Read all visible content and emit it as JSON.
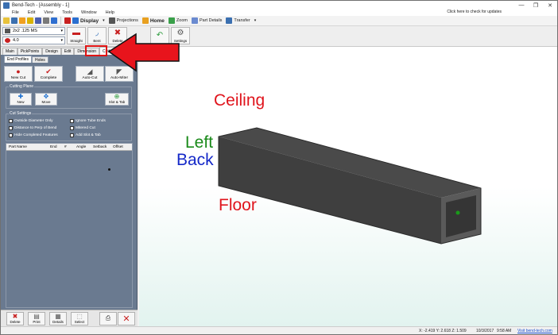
{
  "window": {
    "title": "Bend-Tech - [Assembly - 1]",
    "controls": [
      "—",
      "❐",
      "✕"
    ]
  },
  "menubar": {
    "items": [
      "File",
      "Edit",
      "View",
      "Tools",
      "Window",
      "Help"
    ],
    "update_notice": "Click here to check for updates"
  },
  "toolbar": {
    "display_label": "Display",
    "projections_label": "Projections",
    "home_label": "Home",
    "zoom_label": "Zoom",
    "part_details_label": "Part Details",
    "transfer_label": "Transfer"
  },
  "selectors": {
    "profile_value": "2x2 .125 MS",
    "radius_value": "4.0"
  },
  "bigbuttons": {
    "straight_label": "Straight",
    "bent_label": "Bent",
    "delete_label": "Delete",
    "settings_label": "Settings"
  },
  "tabs": [
    "Main",
    "PickPoints",
    "Design",
    "Edit",
    "Dimension",
    "Cutting"
  ],
  "active_tab": "Cutting",
  "subtabs": [
    "End Profiles",
    "Holes"
  ],
  "actions": {
    "new_cut": "New Cut",
    "complete": "Complete",
    "auto_cut": "Auto-Cut",
    "auto_miter": "Auto-Miter"
  },
  "cutting_plane": {
    "title": "Cutting Plane",
    "new_label": "New",
    "move_label": "Move",
    "slot_tab_label": "Slot & Tab"
  },
  "cut_settings": {
    "title": "Cut Settings",
    "options": [
      "Outside Diameter Only",
      "Ignore Tube Ends",
      "Distance to Perp of Bend",
      "Mitered Cut",
      "Hide Completed Features",
      "Add Slot & Tab"
    ]
  },
  "grid": {
    "columns": [
      "Part Name",
      "End",
      "#",
      "Angle",
      "Setback",
      "Offset"
    ]
  },
  "bottom_buttons": {
    "delete": "Delete",
    "print": "Print",
    "details": "Details",
    "select": "Select"
  },
  "viewport": {
    "labels": {
      "ceiling": "Ceiling",
      "left": "Left",
      "back": "Back",
      "floor": "Floor"
    },
    "colors": {
      "ceiling": "#e0141c",
      "left": "#1a8a1a",
      "back": "#1428c8",
      "floor": "#e0141c",
      "tube": "#444444",
      "callout_arrow": "#e8141c"
    }
  },
  "status": {
    "coords": "X: -2.419  Y: 2.618  Z: 1.509",
    "date": "10/3/2017",
    "time": "9:58 AM",
    "website": "Visit bend-tech.com"
  }
}
